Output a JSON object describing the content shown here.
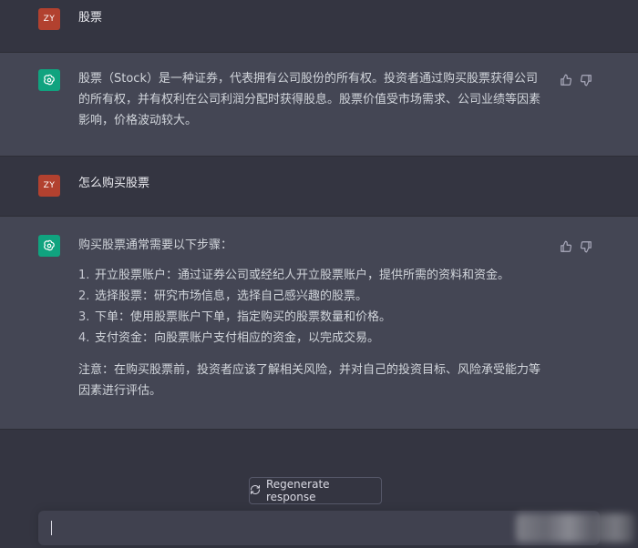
{
  "conversation": [
    {
      "role": "user",
      "avatar_initials": "ZY",
      "text": "股票"
    },
    {
      "role": "assistant",
      "avatar_icon": "openai-logo-icon",
      "text": "股票（Stock）是一种证券，代表拥有公司股份的所有权。投资者通过购买股票获得公司的所有权，并有权利在公司利润分配时获得股息。股票价值受市场需求、公司业绩等因素影响，价格波动较大。"
    },
    {
      "role": "user",
      "avatar_initials": "ZY",
      "text": "怎么购买股票"
    },
    {
      "role": "assistant",
      "avatar_icon": "openai-logo-icon",
      "intro": "购买股票通常需要以下步骤：",
      "steps": [
        {
          "num": "1.",
          "text": "开立股票账户：通过证券公司或经纪人开立股票账户，提供所需的资料和资金。"
        },
        {
          "num": "2.",
          "text": "选择股票：研究市场信息，选择自己感兴趣的股票。"
        },
        {
          "num": "3.",
          "text": "下单：使用股票账户下单，指定购买的股票数量和价格。"
        },
        {
          "num": "4.",
          "text": "支付资金：向股票账户支付相应的资金，以完成交易。"
        }
      ],
      "note": "注意：在购买股票前，投资者应该了解相关风险，并对自己的投资目标、风险承受能力等因素进行评估。"
    }
  ],
  "regenerate_label": "Regenerate response",
  "input": {
    "value": ""
  },
  "colors": {
    "background": "#343541",
    "assistant_row": "#444654",
    "user_avatar": "#b2412f",
    "bot_avatar": "#10a37f"
  }
}
